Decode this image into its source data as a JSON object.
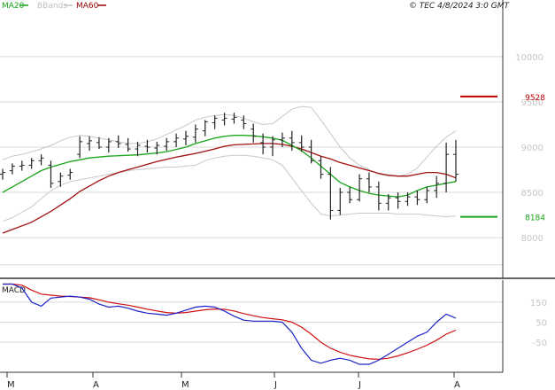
{
  "header": {
    "legend": [
      {
        "label": "MA20",
        "color": "#1aa51a"
      },
      {
        "label": "BBands",
        "color": "#c0c0c0"
      },
      {
        "label": "MA60",
        "color": "#990000"
      }
    ],
    "copyright": "© TEC 4/8/2024 3:0 GMT"
  },
  "colors": {
    "price": "#222222",
    "ma20": "#1aa51a",
    "ma60": "#a01010",
    "bbands": "#c8c8c8",
    "macd": "#1a22c8",
    "signal": "#d01010",
    "grid": "#d8d8d8",
    "axis": "#333333"
  },
  "chart_data": [
    {
      "type": "line",
      "panel": "price",
      "x_labels": [
        "M",
        "A",
        "M",
        "J",
        "J",
        "A"
      ],
      "y_ticks": [
        8000,
        8500,
        9000,
        9500,
        10000
      ],
      "y_tick_labels": [
        "8000",
        "8500",
        "9000",
        "9500",
        "10000"
      ],
      "ylim": [
        7550,
        10450
      ],
      "annotations": [
        {
          "label": "9528",
          "value": 9560,
          "color": "#c00000"
        },
        {
          "label": "8184",
          "value": 8230,
          "color": "#1aa51a"
        }
      ],
      "series": [
        {
          "name": "MA20",
          "values": [
            8500,
            8560,
            8620,
            8680,
            8740,
            8780,
            8810,
            8840,
            8860,
            8880,
            8890,
            8900,
            8905,
            8910,
            8915,
            8925,
            8935,
            8950,
            8975,
            9000,
            9040,
            9070,
            9100,
            9120,
            9130,
            9130,
            9125,
            9115,
            9100,
            9075,
            9020,
            8960,
            8880,
            8790,
            8700,
            8610,
            8560,
            8520,
            8490,
            8470,
            8460,
            8450,
            8470,
            8520,
            8560,
            8580,
            8600,
            8620
          ]
        },
        {
          "name": "MA60",
          "values": [
            8050,
            8090,
            8130,
            8170,
            8230,
            8290,
            8360,
            8430,
            8510,
            8570,
            8630,
            8680,
            8720,
            8750,
            8780,
            8810,
            8840,
            8865,
            8890,
            8910,
            8930,
            8955,
            8980,
            9010,
            9025,
            9030,
            9035,
            9040,
            9040,
            9030,
            9010,
            8980,
            8940,
            8900,
            8870,
            8830,
            8800,
            8770,
            8740,
            8710,
            8690,
            8680,
            8680,
            8700,
            8720,
            8720,
            8700,
            8660
          ]
        },
        {
          "name": "BB Upper",
          "values": [
            8860,
            8900,
            8920,
            8950,
            8980,
            9020,
            9070,
            9110,
            9130,
            9120,
            9100,
            9080,
            9060,
            9040,
            9040,
            9060,
            9090,
            9140,
            9190,
            9240,
            9300,
            9330,
            9350,
            9360,
            9350,
            9320,
            9280,
            9250,
            9260,
            9340,
            9420,
            9450,
            9440,
            9300,
            9150,
            9000,
            8880,
            8800,
            8750,
            8700,
            8680,
            8680,
            8700,
            8770,
            8890,
            9010,
            9110,
            9180
          ]
        },
        {
          "name": "BB Lower",
          "values": [
            8180,
            8220,
            8280,
            8340,
            8430,
            8520,
            8580,
            8620,
            8640,
            8660,
            8680,
            8700,
            8720,
            8740,
            8750,
            8760,
            8770,
            8780,
            8780,
            8790,
            8800,
            8850,
            8880,
            8900,
            8910,
            8910,
            8900,
            8880,
            8860,
            8800,
            8660,
            8520,
            8380,
            8260,
            8240,
            8250,
            8260,
            8270,
            8270,
            8270,
            8270,
            8260,
            8260,
            8260,
            8250,
            8240,
            8230,
            8240
          ]
        }
      ],
      "ohlc": [
        [
          8700,
          8760,
          8640,
          8720
        ],
        [
          8740,
          8820,
          8700,
          8790
        ],
        [
          8790,
          8850,
          8740,
          8800
        ],
        [
          8800,
          8880,
          8760,
          8850
        ],
        [
          8850,
          8920,
          8800,
          8880
        ],
        [
          8800,
          8850,
          8550,
          8600
        ],
        [
          8620,
          8720,
          8560,
          8680
        ],
        [
          8690,
          8760,
          8640,
          8720
        ],
        [
          8920,
          9120,
          8880,
          9060
        ],
        [
          9040,
          9120,
          8960,
          9070
        ],
        [
          9050,
          9110,
          8980,
          9000
        ],
        [
          9000,
          9100,
          8940,
          9060
        ],
        [
          9060,
          9130,
          8990,
          9040
        ],
        [
          9030,
          9100,
          8950,
          8980
        ],
        [
          8980,
          9060,
          8900,
          9020
        ],
        [
          9010,
          9080,
          8940,
          9000
        ],
        [
          8990,
          9060,
          8920,
          9020
        ],
        [
          9010,
          9100,
          8960,
          9060
        ],
        [
          9060,
          9150,
          9000,
          9100
        ],
        [
          9090,
          9180,
          9020,
          9120
        ],
        [
          9110,
          9250,
          9050,
          9200
        ],
        [
          9180,
          9300,
          9120,
          9280
        ],
        [
          9270,
          9350,
          9200,
          9320
        ],
        [
          9300,
          9380,
          9240,
          9320
        ],
        [
          9310,
          9380,
          9260,
          9330
        ],
        [
          9300,
          9350,
          9200,
          9260
        ],
        [
          9200,
          9260,
          9050,
          9120
        ],
        [
          9050,
          9150,
          8920,
          9000
        ],
        [
          9000,
          9120,
          8900,
          9080
        ],
        [
          9080,
          9160,
          9000,
          9100
        ],
        [
          9100,
          9180,
          8960,
          9050
        ],
        [
          9050,
          9130,
          8950,
          9000
        ],
        [
          9000,
          9080,
          8820,
          8850
        ],
        [
          8850,
          8900,
          8650,
          8700
        ],
        [
          8700,
          8780,
          8200,
          8300
        ],
        [
          8300,
          8550,
          8250,
          8500
        ],
        [
          8500,
          8560,
          8380,
          8420
        ],
        [
          8420,
          8700,
          8400,
          8650
        ],
        [
          8650,
          8720,
          8500,
          8560
        ],
        [
          8560,
          8620,
          8300,
          8380
        ],
        [
          8380,
          8480,
          8300,
          8440
        ],
        [
          8440,
          8500,
          8320,
          8400
        ],
        [
          8400,
          8500,
          8350,
          8450
        ],
        [
          8450,
          8520,
          8360,
          8420
        ],
        [
          8420,
          8560,
          8380,
          8520
        ],
        [
          8520,
          8680,
          8440,
          8600
        ],
        [
          8600,
          9050,
          8500,
          8920
        ],
        [
          8920,
          9080,
          8620,
          8700
        ]
      ]
    },
    {
      "type": "line",
      "panel": "MACD",
      "title": "MACD",
      "y_ticks": [
        150,
        50,
        -50
      ],
      "y_tick_labels": [
        "150",
        "50",
        "-50"
      ],
      "ylim": [
        -200,
        260
      ],
      "series": [
        {
          "name": "MACD",
          "values": [
            240,
            240,
            220,
            150,
            130,
            170,
            175,
            180,
            175,
            165,
            140,
            125,
            130,
            120,
            105,
            95,
            90,
            85,
            95,
            110,
            125,
            130,
            125,
            105,
            80,
            60,
            55,
            55,
            55,
            50,
            0,
            -80,
            -140,
            -155,
            -140,
            -130,
            -140,
            -160,
            -160,
            -140,
            -110,
            -80,
            -50,
            -20,
            0,
            50,
            90,
            70
          ]
        },
        {
          "name": "Signal",
          "values": [
            240,
            240,
            235,
            210,
            190,
            185,
            180,
            178,
            175,
            172,
            162,
            150,
            142,
            135,
            125,
            115,
            106,
            98,
            95,
            98,
            105,
            112,
            116,
            114,
            106,
            93,
            82,
            73,
            67,
            62,
            50,
            25,
            -10,
            -50,
            -80,
            -100,
            -115,
            -125,
            -133,
            -135,
            -130,
            -118,
            -103,
            -85,
            -65,
            -40,
            -10,
            10
          ]
        }
      ]
    }
  ]
}
